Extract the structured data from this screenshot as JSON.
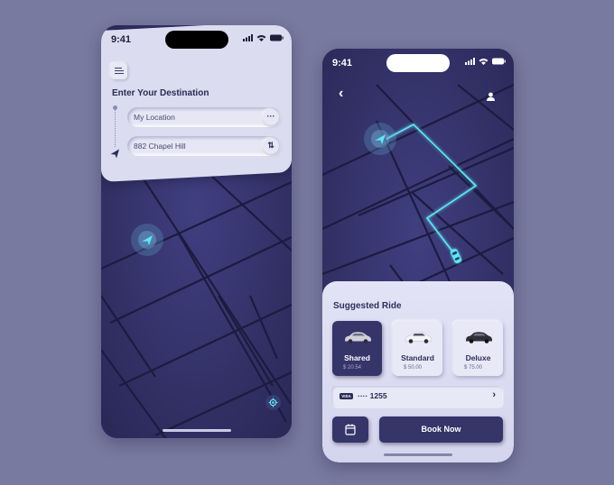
{
  "colors": {
    "page_bg": "#787aa0",
    "map_dark": "#302f62",
    "accent_cyan": "#5fe6f2",
    "card_light": "#dcdcf0",
    "button_dark": "#35356a",
    "text_dark": "#2a2a55"
  },
  "phone1": {
    "status": {
      "time": "9:41",
      "icons": [
        "signal-icon",
        "wifi-icon",
        "battery-icon"
      ]
    },
    "menu_icon": "menu-icon",
    "destination_title": "Enter Your Destination",
    "origin_field": {
      "value": "My Location",
      "action_icon": "more-icon",
      "action_glyph": "···"
    },
    "destination_field": {
      "value": "882 Chapel Hill",
      "action_icon": "swap-icon",
      "action_glyph": "⇅"
    },
    "map": {
      "current_location_icon": "navigation-arrow-icon",
      "locate_icon": "locate-icon"
    }
  },
  "phone2": {
    "status": {
      "time": "9:41",
      "icons": [
        "signal-icon",
        "wifi-icon",
        "battery-icon"
      ]
    },
    "back_glyph": "‹",
    "map": {
      "start_icon": "navigation-arrow-icon",
      "car_icon": "car-icon"
    },
    "suggested_title": "Suggested Ride",
    "rides": [
      {
        "name": "Shared",
        "price": "$ 20.54",
        "selected": true
      },
      {
        "name": "Standard",
        "price": "$ 50.00",
        "selected": false
      },
      {
        "name": "Deluxe",
        "price": "$ 75.00",
        "selected": false
      }
    ],
    "payment": {
      "brand": "VISA",
      "card_masked": "···· 1255",
      "chevron": "›"
    },
    "book_label": "Book Now"
  }
}
